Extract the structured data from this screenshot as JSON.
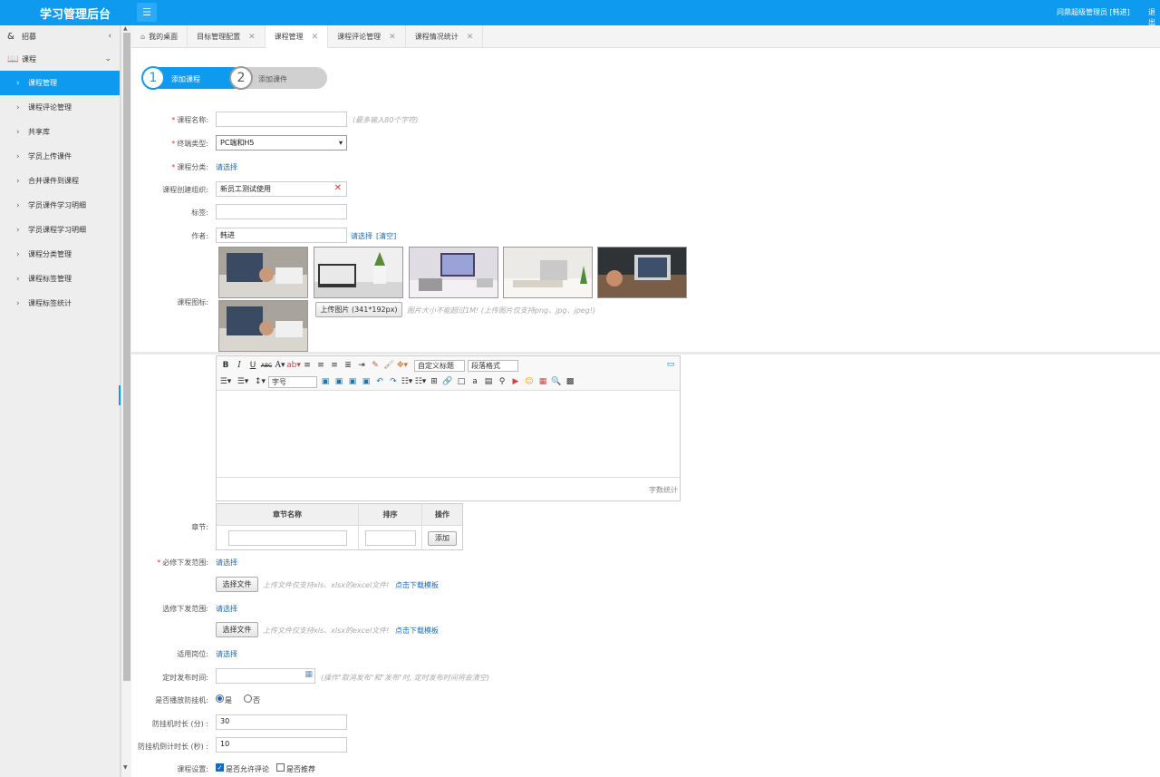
{
  "header": {
    "brand": "学习管理后台",
    "user": "问鼎超级管理员 [韩进]",
    "logout": "退出"
  },
  "sidebar": {
    "groups": [
      {
        "label": "招募",
        "icon": "&"
      },
      {
        "label": "课程"
      }
    ],
    "items": [
      {
        "label": "课程管理",
        "active": true
      },
      {
        "label": "课程评论管理"
      },
      {
        "label": "共享库"
      },
      {
        "label": "学员上传课件"
      },
      {
        "label": "合并课件到课程"
      },
      {
        "label": "学员课件学习明细"
      },
      {
        "label": "学员课程学习明细"
      },
      {
        "label": "课程分类管理"
      },
      {
        "label": "课程标签管理"
      },
      {
        "label": "课程标签统计"
      }
    ]
  },
  "tabs": [
    {
      "label": "我的桌面"
    },
    {
      "label": "目标管理配置"
    },
    {
      "label": "课程管理",
      "active": true
    },
    {
      "label": "课程评论管理"
    },
    {
      "label": "课程情况统计"
    }
  ],
  "stepper": {
    "step1_num": "1",
    "step1_label": "添加课程",
    "step2_num": "2",
    "step2_label": "添加课件"
  },
  "form": {
    "course_name_label": "课程名称:",
    "course_name_hint": "(最多输入80个字符)",
    "terminal_label": "终端类型:",
    "terminal_value": "PC端和H5",
    "category_label": "课程分类:",
    "category_link": "请选择",
    "org_label": "课程创建组织:",
    "org_value": "新员工测试使用",
    "tag_label": "标签:",
    "author_label": "作者:",
    "author_value": "韩进",
    "author_select": "请选择",
    "author_clear": "[清空]",
    "icon_label": "课程图标:",
    "upload_btn": "上传图片 (341*192px)",
    "upload_hint": "图片大小不能超过1M! (上传图片仅支持png、jpg、jpeg!)",
    "chapter_label": "章节:",
    "chapter_col_name": "章节名称",
    "chapter_col_order": "排序",
    "chapter_col_action": "操作",
    "chapter_add": "添加",
    "required_scope_label": "必修下发范围:",
    "required_scope_link": "请选择",
    "file_btn": "选择文件",
    "file_hint": "上传文件仅支持xls、xlsx的excel文件!",
    "download_tpl": "点击下载模板",
    "elective_scope_label": "选修下发范围:",
    "elective_scope_link": "请选择",
    "position_label": "适用岗位:",
    "position_link": "请选择",
    "publish_time_label": "定时发布时间:",
    "publish_time_hint": "(操作\"取消发布\"和\"发布\"时, 定时发布时间将会清空)",
    "anti_hang_label": "是否播放防挂机:",
    "anti_hang_yes": "是",
    "anti_hang_no": "否",
    "anti_hang_minutes_label": "防挂机时长 (分) :",
    "anti_hang_minutes_value": "30",
    "countdown_label": "防挂机倒计时长 (秒) :",
    "countdown_value": "10",
    "settings_label": "课程设置:",
    "allow_comment": "是否允许评论",
    "recommend": "是否推荐"
  },
  "editor": {
    "heading_select": "自定义标题",
    "para_select": "段落格式",
    "font_size_select": "字号",
    "word_count": "字数统计"
  }
}
